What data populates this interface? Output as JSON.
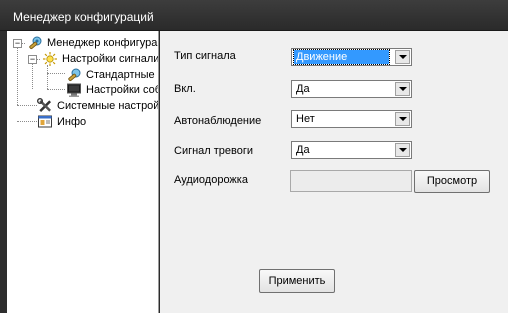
{
  "window": {
    "title": "Менеджер конфигураций"
  },
  "tree": {
    "items": [
      {
        "label": "Менеджер конфигураций",
        "icon": "config-manager-icon",
        "expander": "−"
      },
      {
        "label": "Настройки сигнализации",
        "icon": "alarm-settings-icon",
        "expander": "−"
      },
      {
        "label": "Стандартные настройки",
        "icon": "standard-settings-icon"
      },
      {
        "label": "Настройки событий",
        "icon": "monitor-icon"
      },
      {
        "label": "Системные настройки",
        "icon": "tools-icon"
      },
      {
        "label": "Инфо",
        "icon": "info-icon"
      }
    ]
  },
  "form": {
    "signal_type": {
      "label": "Тип сигнала",
      "value": "Движение"
    },
    "enabled": {
      "label": "Вкл.",
      "value": "Да"
    },
    "auto_monitoring": {
      "label": "Автонаблюдение",
      "value": "Нет"
    },
    "alarm_signal": {
      "label": "Сигнал тревоги",
      "value": "Да"
    },
    "audio_track": {
      "label": "Аудиодорожка",
      "value": "",
      "browse_label": "Просмотр"
    },
    "apply_label": "Применить"
  },
  "colors": {
    "selection": "#3399ff",
    "panel_bg": "#f0f0f0",
    "titlebar_bg": "#2b2b2b"
  }
}
